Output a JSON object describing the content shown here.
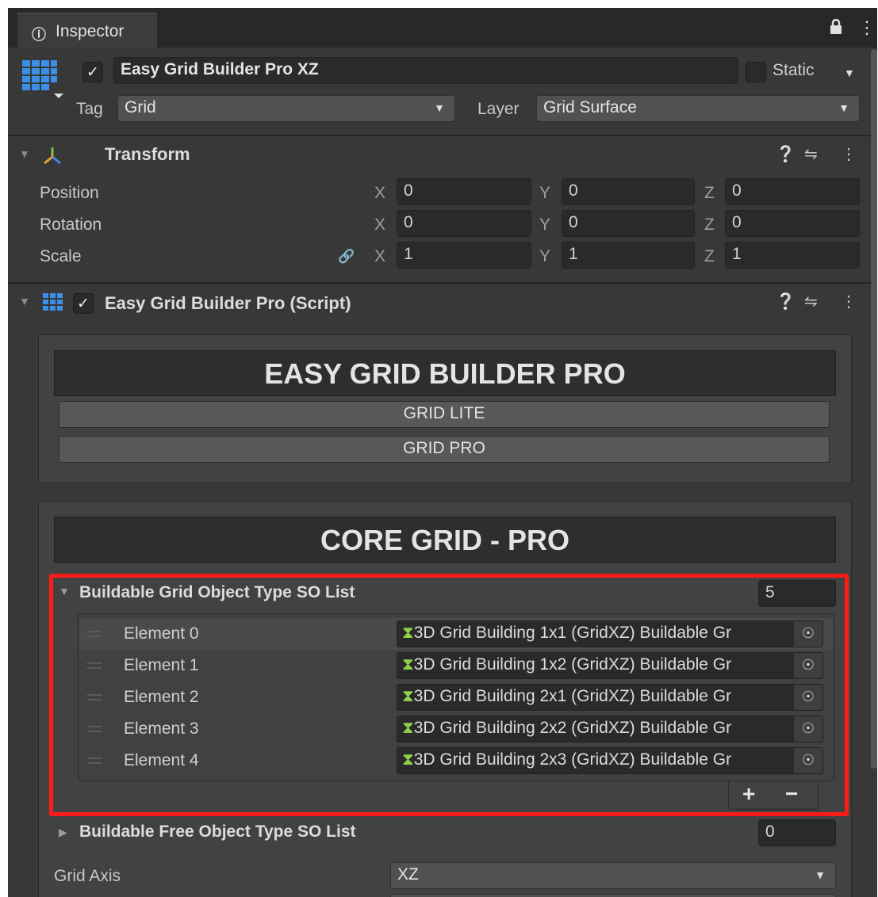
{
  "tab": {
    "icon": "info-icon",
    "label": "Inspector"
  },
  "object": {
    "name": "Easy Grid Builder Pro XZ",
    "static_label": "Static",
    "tag_label": "Tag",
    "tag_value": "Grid",
    "layer_label": "Layer",
    "layer_value": "Grid Surface"
  },
  "transform": {
    "title": "Transform",
    "rows": [
      {
        "label": "Position",
        "x": "0",
        "y": "0",
        "z": "0"
      },
      {
        "label": "Rotation",
        "x": "0",
        "y": "0",
        "z": "0"
      },
      {
        "label": "Scale",
        "x": "1",
        "y": "1",
        "z": "1"
      }
    ],
    "axis_x": "X",
    "axis_y": "Y",
    "axis_z": "Z"
  },
  "script": {
    "title": "Easy Grid Builder Pro (Script)",
    "banner": "EASY GRID BUILDER PRO",
    "buttons": [
      "GRID LITE",
      "GRID PRO"
    ],
    "core_banner": "CORE GRID - PRO",
    "buildable_list": {
      "label": "Buildable Grid Object Type SO List",
      "count": "5",
      "elements": [
        {
          "label": "Element 0",
          "value": "3D Grid Building 1x1 (GridXZ) Buildable Gr"
        },
        {
          "label": "Element 1",
          "value": "3D Grid Building 1x2 (GridXZ) Buildable Gr"
        },
        {
          "label": "Element 2",
          "value": "3D Grid Building 2x1 (GridXZ) Buildable Gr"
        },
        {
          "label": "Element 3",
          "value": "3D Grid Building 2x2 (GridXZ) Buildable Gr"
        },
        {
          "label": "Element 4",
          "value": "3D Grid Building 2x3 (GridXZ) Buildable Gr"
        }
      ],
      "add": "+",
      "remove": "−"
    },
    "free_list": {
      "label": "Buildable Free Object Type SO List",
      "count": "0"
    },
    "grid_axis": {
      "label": "Grid Axis",
      "value": "XZ"
    }
  },
  "colors": {
    "panel": "#383838",
    "highlight": "#ff1a1a",
    "asset_icon": "#8bd14a",
    "transform_icon": "#e8a23a"
  }
}
